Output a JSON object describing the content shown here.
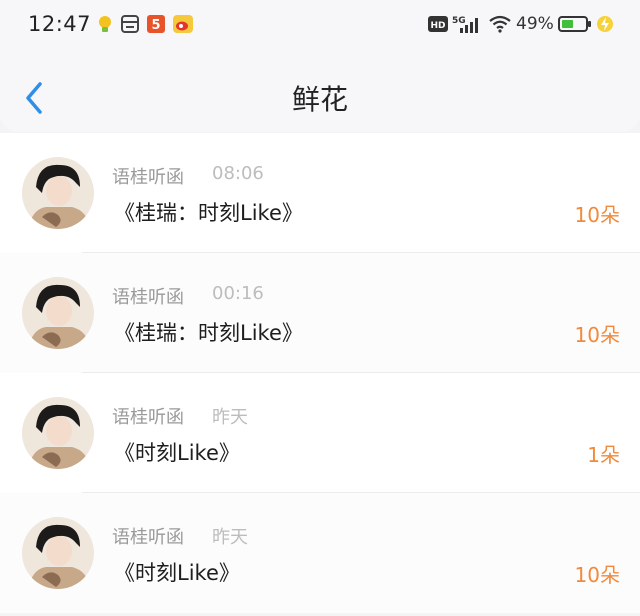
{
  "status_bar": {
    "time": "12:47",
    "battery": "49%",
    "network": "5G",
    "hd_label": "HD"
  },
  "header": {
    "title": "鲜花",
    "back_icon": "chevron-left-icon"
  },
  "colors": {
    "accent_blue": "#2f8fe6",
    "count_orange": "#f08a3c"
  },
  "gifts": [
    {
      "name": "语桂听函",
      "time": "08:06",
      "item": "《桂瑞：时刻Like》",
      "count": "10朵"
    },
    {
      "name": "语桂听函",
      "time": "00:16",
      "item": "《桂瑞：时刻Like》",
      "count": "10朵"
    },
    {
      "name": "语桂听函",
      "time": "昨天",
      "item": "《时刻Like》",
      "count": "1朵"
    },
    {
      "name": "语桂听函",
      "time": "昨天",
      "item": "《时刻Like》",
      "count": "10朵"
    }
  ]
}
